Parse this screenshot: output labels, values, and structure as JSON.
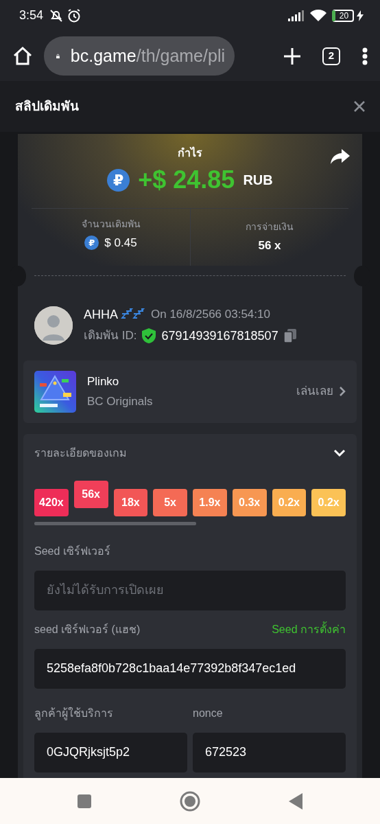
{
  "status_bar": {
    "time": "3:54",
    "battery": "20"
  },
  "browser": {
    "url_host": "bc.game",
    "url_path": "/th/game/pli",
    "tab_count": "2"
  },
  "drawer": {
    "title": "สลิปเดิมพัน"
  },
  "profit": {
    "label": "กำไร",
    "coin": "₽",
    "amount": "+$ 24.85",
    "currency": "RUB"
  },
  "bet": {
    "label": "จำนวนเดิมพัน",
    "coin": "₽",
    "amount": "$ 0.45"
  },
  "payout": {
    "label": "การจ่ายเงิน",
    "value": "56 x"
  },
  "player": {
    "name": "AHHA",
    "date": "On 16/8/2566 03:54:10",
    "id_label": "เดิมพัน ID:",
    "id": "67914939167818507"
  },
  "game": {
    "name": "Plinko",
    "provider": "BC Originals",
    "play": "เล่นเลย"
  },
  "details": {
    "title": "รายละเอียดของเกม",
    "expanded": true,
    "multipliers": [
      {
        "label": "420x",
        "selected": false,
        "color": "#ee2d58"
      },
      {
        "label": "56x",
        "selected": true,
        "color": "#f03f59"
      },
      {
        "label": "18x",
        "selected": false,
        "color": "#f25656"
      },
      {
        "label": "5x",
        "selected": false,
        "color": "#f46a55"
      },
      {
        "label": "1.9x",
        "selected": false,
        "color": "#f58253"
      },
      {
        "label": "0.3x",
        "selected": false,
        "color": "#f79752"
      },
      {
        "label": "0.2x",
        "selected": false,
        "color": "#f9ad50"
      },
      {
        "label": "0.2x",
        "selected": false,
        "color": "#fbc256"
      }
    ],
    "server_seed": {
      "label": "Seed เซิร์ฟเวอร์",
      "placeholder": "ยังไม่ได้รับการเปิดเผย"
    },
    "hashed_seed": {
      "label": "seed เซิร์ฟเวอร์ (แฮช)",
      "link": "Seed การตั้งค่า",
      "value": "5258efa8f0b728c1baa14e77392b8f347ec1ed"
    },
    "client_seed": {
      "label": "ลูกค้าผู้ใช้บริการ",
      "value": "0GJQRjksjt5p2"
    },
    "nonce": {
      "label": "nonce",
      "value": "672523"
    }
  }
}
